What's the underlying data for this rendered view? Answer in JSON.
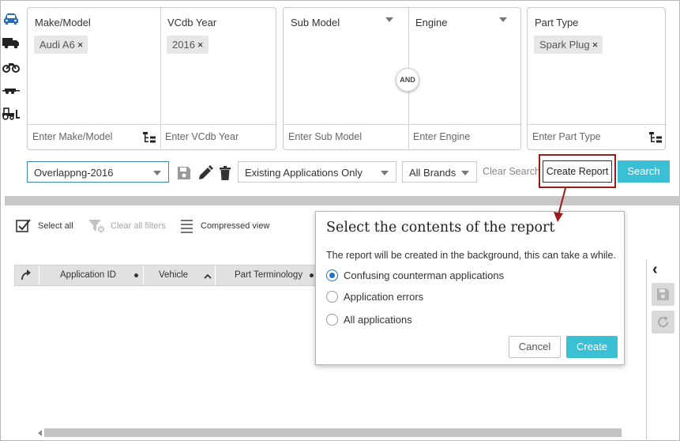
{
  "colors": {
    "accent": "#3bbfd4",
    "highlight_border": "#9b1b1b",
    "active_vehicle_icon": "#2b6cb3",
    "radio_selected": "#1e73be"
  },
  "vehicle_rail": {
    "icons": [
      "car-icon",
      "truck-icon",
      "motorcycle-icon",
      "trailer-icon",
      "tractor-icon"
    ]
  },
  "filters": {
    "make_model": {
      "label": "Make/Model",
      "chip": "Audi A6",
      "placeholder": "Enter Make/Model"
    },
    "vcdb_year": {
      "label": "VCdb Year",
      "chip": "2016",
      "placeholder": "Enter VCdb Year"
    },
    "sub_model": {
      "label": "Sub Model",
      "placeholder": "Enter Sub Model"
    },
    "engine": {
      "label": "Engine",
      "placeholder": "Enter Engine"
    },
    "and_badge": "AND",
    "part_type": {
      "label": "Part Type",
      "chip": "Spark Plug",
      "placeholder": "Enter Part Type"
    },
    "chip_remove_glyph": "×"
  },
  "toolbar": {
    "saved_search": "Overlappng-2016",
    "scope": "Existing Applications Only",
    "brands": "All Brands",
    "clear_search": "Clear Search",
    "create_report": "Create Report",
    "search": "Search"
  },
  "list_actions": {
    "select_all": "Select all",
    "clear_filters": "Clear all filters",
    "compressed_view": "Compressed view"
  },
  "table": {
    "columns": [
      "Application ID",
      "Vehicle",
      "Part Terminology"
    ]
  },
  "dialog": {
    "title": "Select the contents of the report",
    "description": "The report will be created in the background, this can take a while.",
    "options": [
      {
        "label": "Confusing counterman applications",
        "selected": true
      },
      {
        "label": "Application errors",
        "selected": false
      },
      {
        "label": "All applications",
        "selected": false
      }
    ],
    "cancel": "Cancel",
    "create": "Create"
  },
  "side_panel": {
    "collapse_glyph": "‹"
  }
}
